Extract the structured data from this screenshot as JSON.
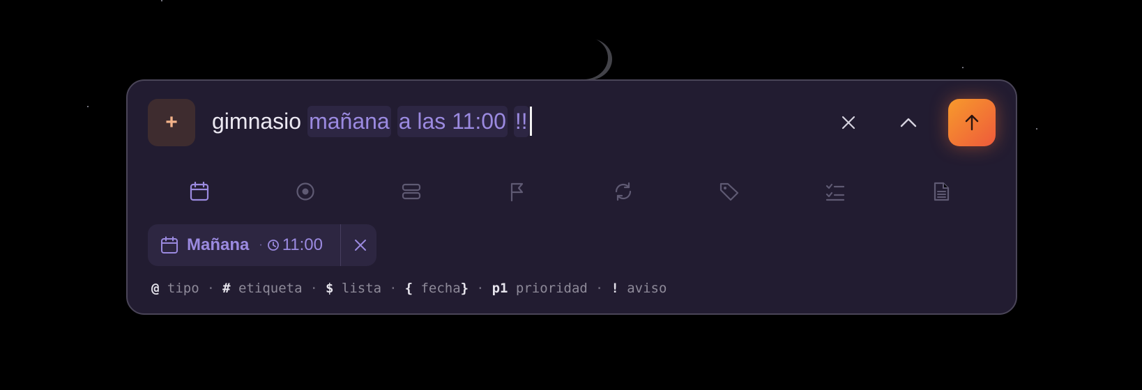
{
  "colors": {
    "background": "#000000",
    "panel": "#221c31",
    "accent_purple": "#9b8ae0",
    "send_gradient_start": "#f79a2c",
    "send_gradient_end": "#ee5a3b",
    "add_button_bg": "#3e2c2f"
  },
  "composer": {
    "add_icon": "plus-icon",
    "input": {
      "plain_text": "gimnasio",
      "date_token": "mañana",
      "time_token": "a las 11:00",
      "priority_token": "!!"
    },
    "clear_icon": "close-icon",
    "collapse_icon": "chevron-up-icon",
    "send_icon": "arrow-up-icon"
  },
  "toolbar": {
    "tools": [
      {
        "icon": "calendar-icon",
        "active": true
      },
      {
        "icon": "target-icon",
        "active": false
      },
      {
        "icon": "list-icon",
        "active": false
      },
      {
        "icon": "flag-icon",
        "active": false
      },
      {
        "icon": "repeat-icon",
        "active": false
      },
      {
        "icon": "tag-icon",
        "active": false
      },
      {
        "icon": "checklist-icon",
        "active": false
      },
      {
        "icon": "document-icon",
        "active": false
      }
    ]
  },
  "date_chip": {
    "icon": "calendar-icon",
    "day": "Mañana",
    "separator": "·",
    "clock_icon": "clock-icon",
    "time": "11:00",
    "remove_icon": "close-icon"
  },
  "hints": [
    {
      "symbol": "@",
      "label": "tipo"
    },
    {
      "symbol": "#",
      "label": "etiqueta"
    },
    {
      "symbol": "$",
      "label": "lista"
    },
    {
      "symbol": "{",
      "label": "fecha",
      "closing": "}"
    },
    {
      "symbol": "p1",
      "label": "prioridad"
    },
    {
      "symbol": "!",
      "label": "aviso"
    }
  ],
  "hint_separator": "·"
}
